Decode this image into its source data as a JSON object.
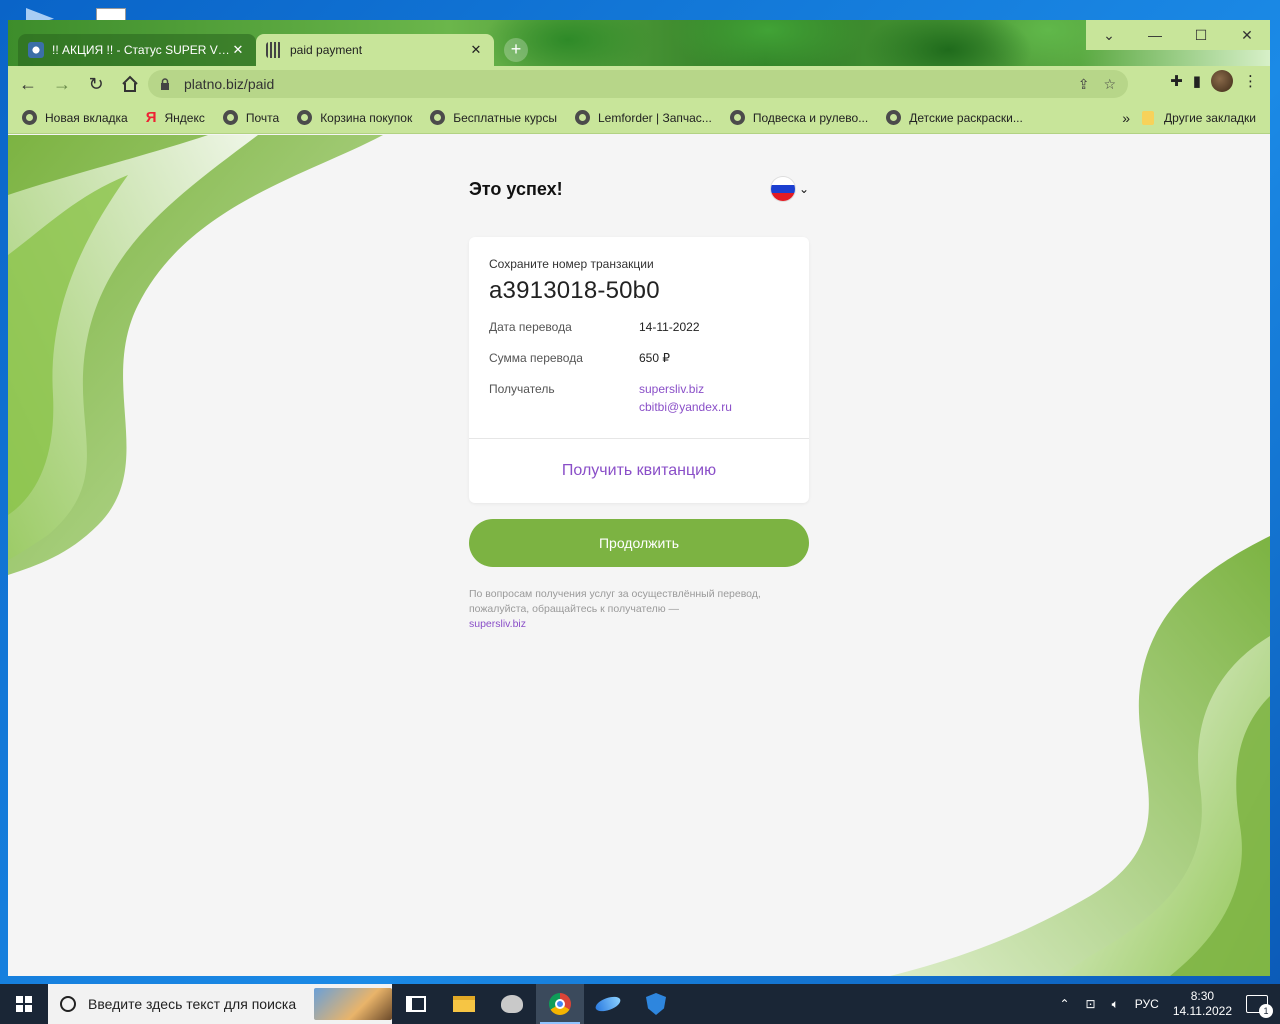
{
  "browser": {
    "tabs": [
      {
        "title": "!! АКЦИЯ !! - Статус SUPER VIP с",
        "active": false
      },
      {
        "title": "paid payment",
        "active": true
      }
    ],
    "url": "platno.biz/paid",
    "bookmarks": [
      {
        "label": "Новая вкладка",
        "icon": "globe-icon"
      },
      {
        "label": "Яндекс",
        "icon": "yandex-icon"
      },
      {
        "label": "Почта",
        "icon": "globe-icon"
      },
      {
        "label": "Корзина покупок",
        "icon": "globe-icon"
      },
      {
        "label": "Бесплатные курсы",
        "icon": "globe-icon"
      },
      {
        "label": "Lemforder | Запчас...",
        "icon": "globe-icon"
      },
      {
        "label": "Подвеска и рулево...",
        "icon": "globe-icon"
      },
      {
        "label": "Детские раскраски...",
        "icon": "globe-icon"
      }
    ],
    "bookmarks_more": "»",
    "other_bookmarks": "Другие закладки"
  },
  "page": {
    "title": "Это успех!",
    "language": "ru",
    "card": {
      "save_label": "Сохраните номер транзакции",
      "transaction_id": "a3913018-50b0",
      "rows": [
        {
          "key": "Дата перевода",
          "value": "14-11-2022"
        },
        {
          "key": "Сумма перевода",
          "value": "650 ₽"
        },
        {
          "key": "Получатель",
          "value": "supersliv.biz",
          "value2": "cbitbi@yandex.ru"
        }
      ],
      "receipt_label": "Получить квитанцию"
    },
    "continue_label": "Продолжить",
    "note_text": "По вопросам получения услуг за осуществлённый перевод, пожалуйста, обращайтесь к получателю —",
    "note_link": "supersliv.biz"
  },
  "taskbar": {
    "search_placeholder": "Введите здесь текст для поиска",
    "language": "РУС",
    "time": "8:30",
    "date": "14.11.2022",
    "notifications": "1"
  },
  "colors": {
    "accent_green": "#7cb342",
    "link_purple": "#8a4fc8",
    "browser_chrome": "#c8e59a"
  }
}
